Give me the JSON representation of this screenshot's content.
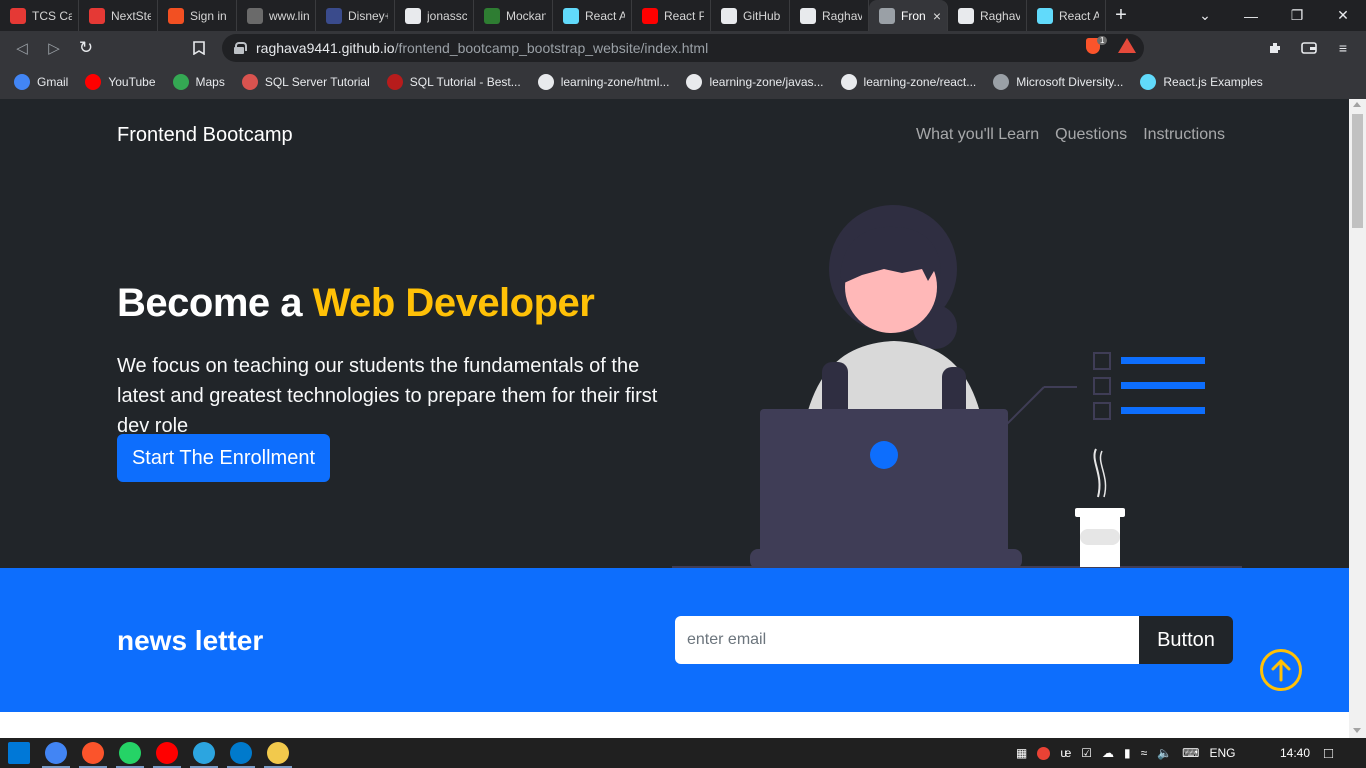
{
  "browser": {
    "tabs": [
      {
        "title": "TCS Car",
        "icon": "tcs-icon",
        "color": "#e53935"
      },
      {
        "title": "NextSte",
        "icon": "tcs-icon",
        "color": "#e53935"
      },
      {
        "title": "Sign in t",
        "icon": "microsoft-icon",
        "color": "#f25022"
      },
      {
        "title": "www.lin",
        "icon": "linkedin-icon",
        "color": "#6a6a6a"
      },
      {
        "title": "Disney+",
        "icon": "disney-icon",
        "color": "#3a4b8c"
      },
      {
        "title": "jonassc",
        "icon": "github-icon",
        "color": "#e8eaed"
      },
      {
        "title": "Mockan",
        "icon": "mockaroo-icon",
        "color": "#2e7d32"
      },
      {
        "title": "React A",
        "icon": "react-icon",
        "color": "#61dafb"
      },
      {
        "title": "React Pr",
        "icon": "youtube-icon",
        "color": "#ff0000"
      },
      {
        "title": "GitHub",
        "icon": "github-icon",
        "color": "#e8eaed"
      },
      {
        "title": "Raghav",
        "icon": "github-icon",
        "color": "#e8eaed"
      },
      {
        "title": "Fron",
        "icon": "globe-icon",
        "color": "#9aa0a6",
        "active": true
      },
      {
        "title": "Raghav",
        "icon": "github-icon",
        "color": "#e8eaed"
      },
      {
        "title": "React A",
        "icon": "react-icon",
        "color": "#61dafb"
      }
    ],
    "url_host": "raghava9441.github.io",
    "url_path": "/frontend_bootcamp_bootstrap_website/index.html",
    "shield_count": "1",
    "bookmarks": [
      {
        "label": "Gmail",
        "icon": "google-icon",
        "color": "#4285f4"
      },
      {
        "label": "YouTube",
        "icon": "youtube-icon",
        "color": "#ff0000"
      },
      {
        "label": "Maps",
        "icon": "maps-icon",
        "color": "#34a853"
      },
      {
        "label": "SQL Server Tutorial",
        "icon": "sqlserver-icon",
        "color": "#d9534f"
      },
      {
        "label": "SQL Tutorial - Best...",
        "icon": "sql-icon",
        "color": "#b71c1c"
      },
      {
        "label": "learning-zone/html...",
        "icon": "github-icon",
        "color": "#e8eaed"
      },
      {
        "label": "learning-zone/javas...",
        "icon": "github-icon",
        "color": "#e8eaed"
      },
      {
        "label": "learning-zone/react...",
        "icon": "github-icon",
        "color": "#e8eaed"
      },
      {
        "label": "Microsoft Diversity...",
        "icon": "globe-icon",
        "color": "#9aa0a6"
      },
      {
        "label": "React.js Examples",
        "icon": "react-icon",
        "color": "#61dafb"
      }
    ]
  },
  "page": {
    "brand": "Frontend Bootcamp",
    "nav": [
      "What you'll Learn",
      "Questions",
      "Instructions"
    ],
    "hero": {
      "title_prefix": "Become a",
      "title_accent": "Web Developer",
      "lead": "We focus on teaching our students the fundamentals of the latest and greatest technologies to prepare them for their first dev role",
      "cta": "Start The Enrollment"
    },
    "newsletter": {
      "title": "news letter",
      "placeholder": "enter email",
      "button": "Button"
    },
    "colors": {
      "dark_bg": "#212529",
      "accent": "#ffc107",
      "primary": "#0d6efd"
    }
  },
  "taskbar": {
    "apps": [
      "windows-icon",
      "chrome-icon",
      "brave-icon",
      "whatsapp-icon",
      "youtube-icon",
      "telegram-icon",
      "vscode-icon",
      "file-explorer-icon"
    ],
    "language": "ENG",
    "time": "14:40"
  }
}
